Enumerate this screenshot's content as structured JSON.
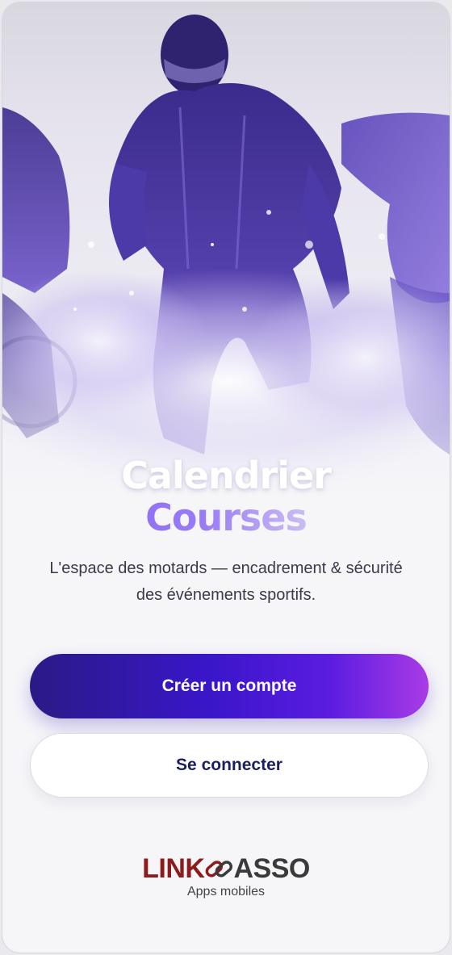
{
  "hero": {
    "title_line1": "Calendrier",
    "title_line2": "Courses",
    "subtitle": "L'espace des motards — encadrement & sécurité des événements sportifs."
  },
  "actions": {
    "create_account_label": "Créer un compte",
    "login_label": "Se connecter"
  },
  "branding": {
    "logo_left": "LINK",
    "logo_right": "ASSO",
    "tagline": "Apps mobiles"
  },
  "colors": {
    "primary_gradient_start": "#2a1a86",
    "primary_gradient_end": "#a93be6",
    "accent_purple": "#7b5cf5",
    "secondary_text": "#1b1f5e",
    "logo_red": "#8c1c1c"
  },
  "icons": {
    "hero_image": "triathlon-athletes-illustration",
    "logo_mark": "chain-link-icon"
  }
}
